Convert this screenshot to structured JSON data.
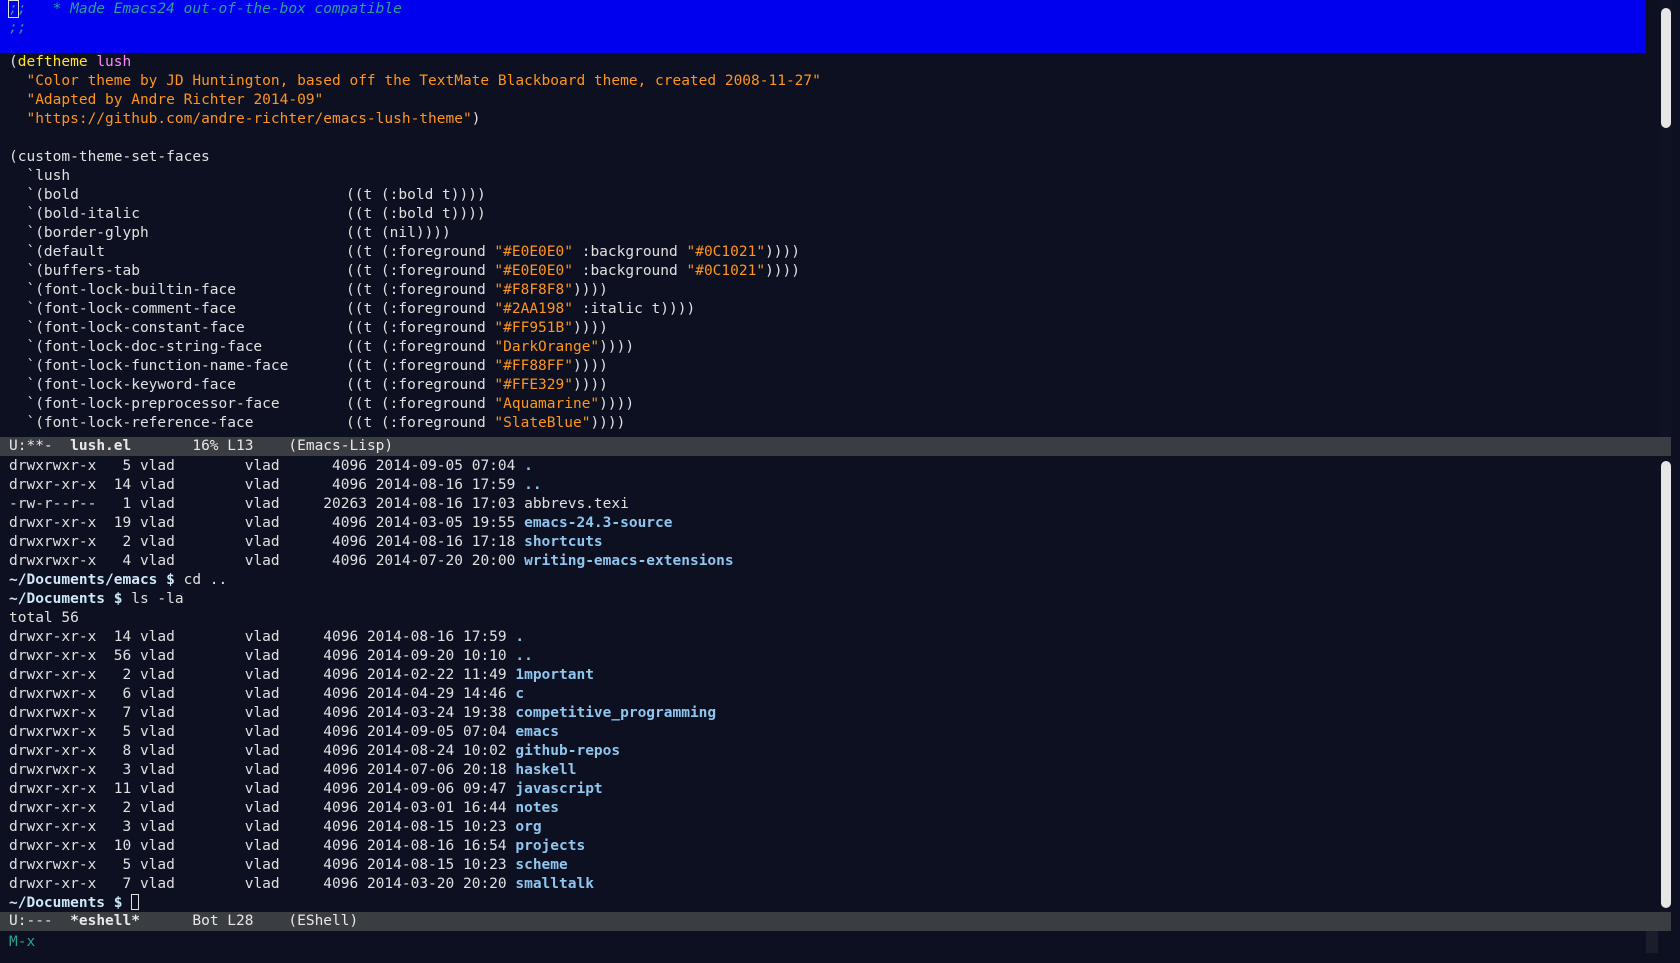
{
  "code_buffer": {
    "lines": [
      {
        "kind": "selected-comment",
        "cursor_char": ";",
        "rest": ";   * Made Emacs24 out-of-the-box compatible"
      },
      {
        "kind": "selected-comment",
        "text": ";;"
      },
      {
        "kind": "selected-blank",
        "text": ""
      },
      {
        "kind": "deftheme",
        "open": "(",
        "keyword": "deftheme",
        "name": "lush"
      },
      {
        "kind": "string",
        "indent": "  ",
        "text": "\"Color theme by JD Huntington, based off the TextMate Blackboard theme, created 2008-11-27\""
      },
      {
        "kind": "string",
        "indent": "  ",
        "text": "\"Adapted by Andre Richter 2014-09\""
      },
      {
        "kind": "string",
        "indent": "  ",
        "text": "\"https://github.com/andre-richter/emacs-lush-theme\"",
        "tail": ")"
      },
      {
        "kind": "blank",
        "text": ""
      },
      {
        "kind": "plain",
        "text": "(custom-theme-set-faces"
      },
      {
        "kind": "plain",
        "text": "  `lush"
      },
      {
        "kind": "face",
        "name": "  `(bold",
        "spec": "((t (:bold t))))"
      },
      {
        "kind": "face",
        "name": "  `(bold-italic",
        "spec": "((t (:bold t))))"
      },
      {
        "kind": "face",
        "name": "  `(border-glyph",
        "spec": "((t (nil))))"
      },
      {
        "kind": "face2",
        "name": "  `(default",
        "pre": "((t (:foreground ",
        "s1": "\"#E0E0E0\"",
        "mid": " :background ",
        "s2": "\"#0C1021\"",
        "post": "))))"
      },
      {
        "kind": "face2",
        "name": "  `(buffers-tab",
        "pre": "((t (:foreground ",
        "s1": "\"#E0E0E0\"",
        "mid": " :background ",
        "s2": "\"#0C1021\"",
        "post": "))))"
      },
      {
        "kind": "face1",
        "name": "  `(font-lock-builtin-face",
        "pre": "((t (:foreground ",
        "s1": "\"#F8F8F8\"",
        "post": "))))"
      },
      {
        "kind": "face1",
        "name": "  `(font-lock-comment-face",
        "pre": "((t (:foreground ",
        "s1": "\"#2AA198\"",
        "post": " :italic t))))"
      },
      {
        "kind": "face1",
        "name": "  `(font-lock-constant-face",
        "pre": "((t (:foreground ",
        "s1": "\"#FF951B\"",
        "post": "))))"
      },
      {
        "kind": "face1",
        "name": "  `(font-lock-doc-string-face",
        "pre": "((t (:foreground ",
        "s1": "\"DarkOrange\"",
        "post": "))))"
      },
      {
        "kind": "face1",
        "name": "  `(font-lock-function-name-face",
        "pre": "((t (:foreground ",
        "s1": "\"#FF88FF\"",
        "post": "))))"
      },
      {
        "kind": "face1",
        "name": "  `(font-lock-keyword-face",
        "pre": "((t (:foreground ",
        "s1": "\"#FFE329\"",
        "post": "))))"
      },
      {
        "kind": "face1",
        "name": "  `(font-lock-preprocessor-face",
        "pre": "((t (:foreground ",
        "s1": "\"Aquamarine\"",
        "post": "))))"
      },
      {
        "kind": "face1",
        "name": "  `(font-lock-reference-face",
        "pre": "((t (:foreground ",
        "s1": "\"SlateBlue\"",
        "post": "))))"
      }
    ]
  },
  "code_modeline": {
    "status": "U:**-",
    "buffer": "lush.el",
    "position": "16% L13",
    "mode": "(Emacs-Lisp)"
  },
  "shell_buffer": {
    "lines": [
      {
        "kind": "ls",
        "perms": "drwxrwxr-x",
        "links": "5",
        "owner": "vlad",
        "group": "vlad",
        "size": "4096",
        "date": "2014-09-05 07:04",
        "name": ".",
        "is_dir": true
      },
      {
        "kind": "ls",
        "perms": "drwxr-xr-x",
        "links": "14",
        "owner": "vlad",
        "group": "vlad",
        "size": "4096",
        "date": "2014-08-16 17:59",
        "name": "..",
        "is_dir": true
      },
      {
        "kind": "ls",
        "perms": "-rw-r--r--",
        "links": "1",
        "owner": "vlad",
        "group": "vlad",
        "size": "20263",
        "date": "2014-08-16 17:03",
        "name": "abbrevs.texi",
        "is_dir": false
      },
      {
        "kind": "ls",
        "perms": "drwxr-xr-x",
        "links": "19",
        "owner": "vlad",
        "group": "vlad",
        "size": "4096",
        "date": "2014-03-05 19:55",
        "name": "emacs-24.3-source",
        "is_dir": true
      },
      {
        "kind": "ls",
        "perms": "drwxrwxr-x",
        "links": "2",
        "owner": "vlad",
        "group": "vlad",
        "size": "4096",
        "date": "2014-08-16 17:18",
        "name": "shortcuts",
        "is_dir": true
      },
      {
        "kind": "ls",
        "perms": "drwxrwxr-x",
        "links": "4",
        "owner": "vlad",
        "group": "vlad",
        "size": "4096",
        "date": "2014-07-20 20:00",
        "name": "writing-emacs-extensions",
        "is_dir": true
      },
      {
        "kind": "prompt",
        "prompt": "~/Documents/emacs $",
        "command": "cd .."
      },
      {
        "kind": "prompt",
        "prompt": "~/Documents $",
        "command": "ls -la"
      },
      {
        "kind": "plain",
        "text": "total 56"
      },
      {
        "kind": "ls2",
        "perms": "drwxr-xr-x",
        "links": "14",
        "owner": "vlad",
        "group": "vlad",
        "size": "4096",
        "date": "2014-08-16 17:59",
        "name": ".",
        "is_dir": true
      },
      {
        "kind": "ls2",
        "perms": "drwxr-xr-x",
        "links": "56",
        "owner": "vlad",
        "group": "vlad",
        "size": "4096",
        "date": "2014-09-20 10:10",
        "name": "..",
        "is_dir": true
      },
      {
        "kind": "ls2",
        "perms": "drwxr-xr-x",
        "links": "2",
        "owner": "vlad",
        "group": "vlad",
        "size": "4096",
        "date": "2014-02-22 11:49",
        "name": "1mportant",
        "is_dir": true
      },
      {
        "kind": "ls2",
        "perms": "drwxrwxr-x",
        "links": "6",
        "owner": "vlad",
        "group": "vlad",
        "size": "4096",
        "date": "2014-04-29 14:46",
        "name": "c",
        "is_dir": true
      },
      {
        "kind": "ls2",
        "perms": "drwxrwxr-x",
        "links": "7",
        "owner": "vlad",
        "group": "vlad",
        "size": "4096",
        "date": "2014-03-24 19:38",
        "name": "competitive_programming",
        "is_dir": true
      },
      {
        "kind": "ls2",
        "perms": "drwxrwxr-x",
        "links": "5",
        "owner": "vlad",
        "group": "vlad",
        "size": "4096",
        "date": "2014-09-05 07:04",
        "name": "emacs",
        "is_dir": true
      },
      {
        "kind": "ls2",
        "perms": "drwxr-xr-x",
        "links": "8",
        "owner": "vlad",
        "group": "vlad",
        "size": "4096",
        "date": "2014-08-24 10:02",
        "name": "github-repos",
        "is_dir": true
      },
      {
        "kind": "ls2",
        "perms": "drwxrwxr-x",
        "links": "3",
        "owner": "vlad",
        "group": "vlad",
        "size": "4096",
        "date": "2014-07-06 20:18",
        "name": "haskell",
        "is_dir": true
      },
      {
        "kind": "ls2",
        "perms": "drwxr-xr-x",
        "links": "11",
        "owner": "vlad",
        "group": "vlad",
        "size": "4096",
        "date": "2014-09-06 09:47",
        "name": "javascript",
        "is_dir": true
      },
      {
        "kind": "ls2",
        "perms": "drwxr-xr-x",
        "links": "2",
        "owner": "vlad",
        "group": "vlad",
        "size": "4096",
        "date": "2014-03-01 16:44",
        "name": "notes",
        "is_dir": true
      },
      {
        "kind": "ls2",
        "perms": "drwxr-xr-x",
        "links": "3",
        "owner": "vlad",
        "group": "vlad",
        "size": "4096",
        "date": "2014-08-15 10:23",
        "name": "org",
        "is_dir": true
      },
      {
        "kind": "ls2",
        "perms": "drwxr-xr-x",
        "links": "10",
        "owner": "vlad",
        "group": "vlad",
        "size": "4096",
        "date": "2014-08-16 16:54",
        "name": "projects",
        "is_dir": true
      },
      {
        "kind": "ls2",
        "perms": "drwxrwxr-x",
        "links": "5",
        "owner": "vlad",
        "group": "vlad",
        "size": "4096",
        "date": "2014-08-15 10:23",
        "name": "scheme",
        "is_dir": true
      },
      {
        "kind": "ls2",
        "perms": "drwxr-xr-x",
        "links": "7",
        "owner": "vlad",
        "group": "vlad",
        "size": "4096",
        "date": "2014-03-20 20:20",
        "name": "smalltalk",
        "is_dir": true
      },
      {
        "kind": "prompt-cursor",
        "prompt": "~/Documents $",
        "command": ""
      }
    ]
  },
  "shell_modeline": {
    "status": "U:---",
    "buffer": "*eshell*",
    "position": "Bot L28",
    "mode": "(EShell)"
  },
  "minibuffer": {
    "text": "M-x"
  },
  "colors": {
    "background": "#0C1021",
    "foreground": "#E0E0E0",
    "selection": "#0000EE",
    "comment": "#2AA198",
    "keyword": "#FFE329",
    "string": "#FF951B",
    "function": "#FF88FF",
    "directory": "#8FC6F0",
    "modeline": "#3a3d42"
  }
}
